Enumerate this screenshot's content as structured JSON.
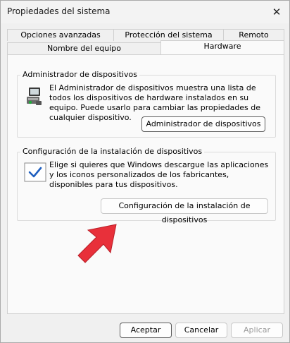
{
  "window": {
    "title": "Propiedades del sistema",
    "close_icon": "close-icon"
  },
  "tabs_row1": [
    "Opciones avanzadas",
    "Protección del sistema",
    "Remoto"
  ],
  "tabs_row2": [
    "Nombre del equipo",
    "Hardware"
  ],
  "active_tab": "Hardware",
  "device_manager": {
    "title": "Administrador de dispositivos",
    "description": "El Administrador de dispositivos muestra una lista de todos los dispositivos de hardware instalados en su equipo. Puede usarlo para cambiar las propiedades de cualquier dispositivo.",
    "button": "Administrador de dispositivos",
    "icon": "device-manager-icon"
  },
  "install_settings": {
    "title": "Configuración de la instalación de dispositivos",
    "description": "Elige si quieres que Windows descargue las aplicaciones y los iconos personalizados de los fabricantes, disponibles para tus dispositivos.",
    "button": "Configuración de la instalación de dispositivos",
    "icon": "checkmark-icon"
  },
  "buttons": {
    "ok": "Aceptar",
    "cancel": "Cancelar",
    "apply": "Aplicar"
  },
  "annotation": {
    "icon": "arrow-pointer-icon",
    "color": "#e8303a"
  }
}
